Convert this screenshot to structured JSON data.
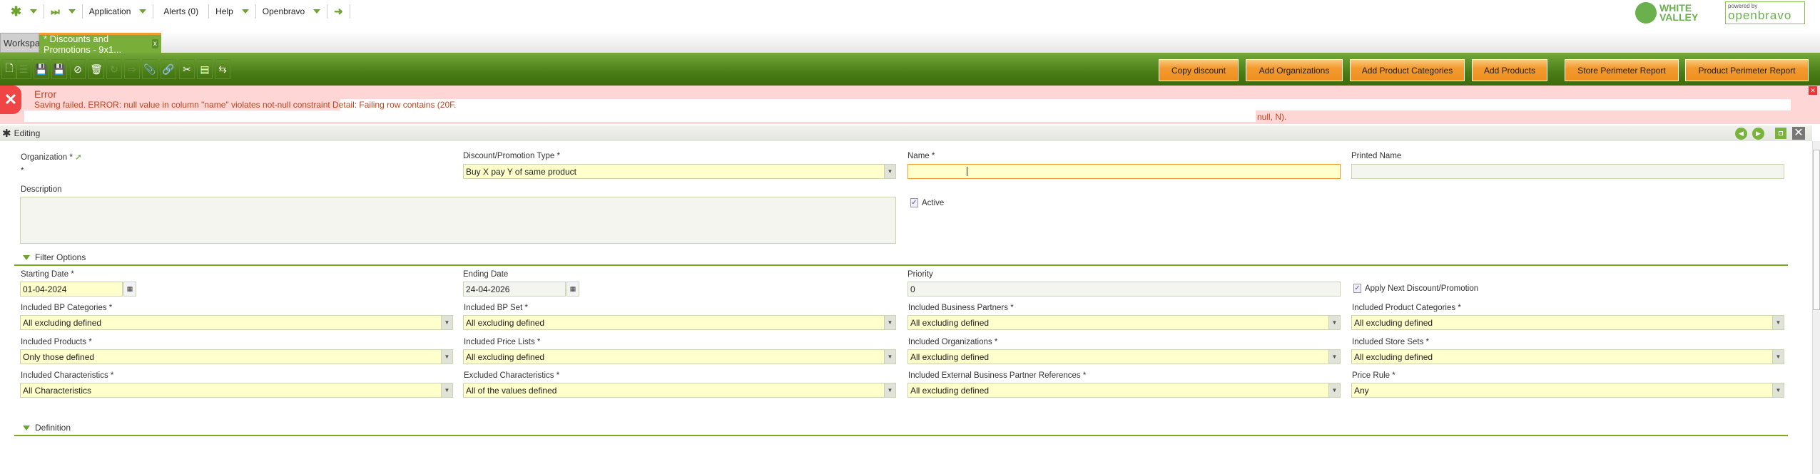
{
  "nav": {
    "application": "Application",
    "alerts": "Alerts (0)",
    "help": "Help",
    "openbravo": "Openbravo"
  },
  "logos": {
    "white_valley": [
      "WHITE",
      "VALLEY"
    ],
    "powered_by": "powered by",
    "openbravo": "openbravo"
  },
  "tabs": [
    {
      "label": "Workspace"
    },
    {
      "label": "* Discounts and Promotions - 9x1...",
      "close": "x"
    }
  ],
  "toolbar": {
    "icons": [
      "new-document-icon",
      "new-row-icon",
      "save-icon",
      "save-close-icon",
      "undo-icon",
      "delete-icon",
      "refresh-icon",
      "export-icon",
      "attachment-icon",
      "link-icon",
      "tools-icon",
      "form-view-icon",
      "audit-icon"
    ],
    "buttons": [
      "Copy discount",
      "Add Organizations",
      "Add Product Categories",
      "Add Products",
      "Store Perimeter Report",
      "Product Perimeter Report"
    ]
  },
  "error": {
    "title": "Error",
    "message": "Saving failed. ERROR: null value in column \"name\" violates not-null constraint Detail: Failing row contains (20F.",
    "tail": "null, N)."
  },
  "editing": {
    "label": "Editing"
  },
  "form": {
    "organization": {
      "label": "Organization *",
      "value": "*"
    },
    "promo_type": {
      "label": "Discount/Promotion Type *",
      "value": "Buy X pay Y of same product"
    },
    "name": {
      "label": "Name *",
      "value": ""
    },
    "printed_name": {
      "label": "Printed Name",
      "value": ""
    },
    "description": {
      "label": "Description",
      "value": ""
    },
    "active": {
      "label": "Active",
      "checked": true
    }
  },
  "filter": {
    "title": "Filter Options",
    "starting_date": {
      "label": "Starting Date *",
      "value": "01-04-2024"
    },
    "ending_date": {
      "label": "Ending Date",
      "value": "24-04-2026"
    },
    "priority": {
      "label": "Priority",
      "value": "0"
    },
    "apply_next": {
      "label": "Apply Next Discount/Promotion",
      "checked": true
    },
    "rows": [
      [
        {
          "label": "Included BP Categories *",
          "value": "All excluding defined"
        },
        {
          "label": "Included BP Set *",
          "value": "All excluding defined"
        },
        {
          "label": "Included Business Partners *",
          "value": "All excluding defined"
        },
        {
          "label": "Included Product Categories *",
          "value": "All excluding defined"
        }
      ],
      [
        {
          "label": "Included Products *",
          "value": "Only those defined"
        },
        {
          "label": "Included Price Lists *",
          "value": "All excluding defined"
        },
        {
          "label": "Included Organizations *",
          "value": "All excluding defined"
        },
        {
          "label": "Included Store Sets *",
          "value": "All excluding defined"
        }
      ],
      [
        {
          "label": "Included Characteristics *",
          "value": "All Characteristics"
        },
        {
          "label": "Excluded Characteristics *",
          "value": "All of the values defined"
        },
        {
          "label": "Included External Business Partner References *",
          "value": "All excluding defined"
        },
        {
          "label": "Price Rule *",
          "value": "Any"
        }
      ]
    ]
  },
  "definition": {
    "title": "Definition"
  }
}
